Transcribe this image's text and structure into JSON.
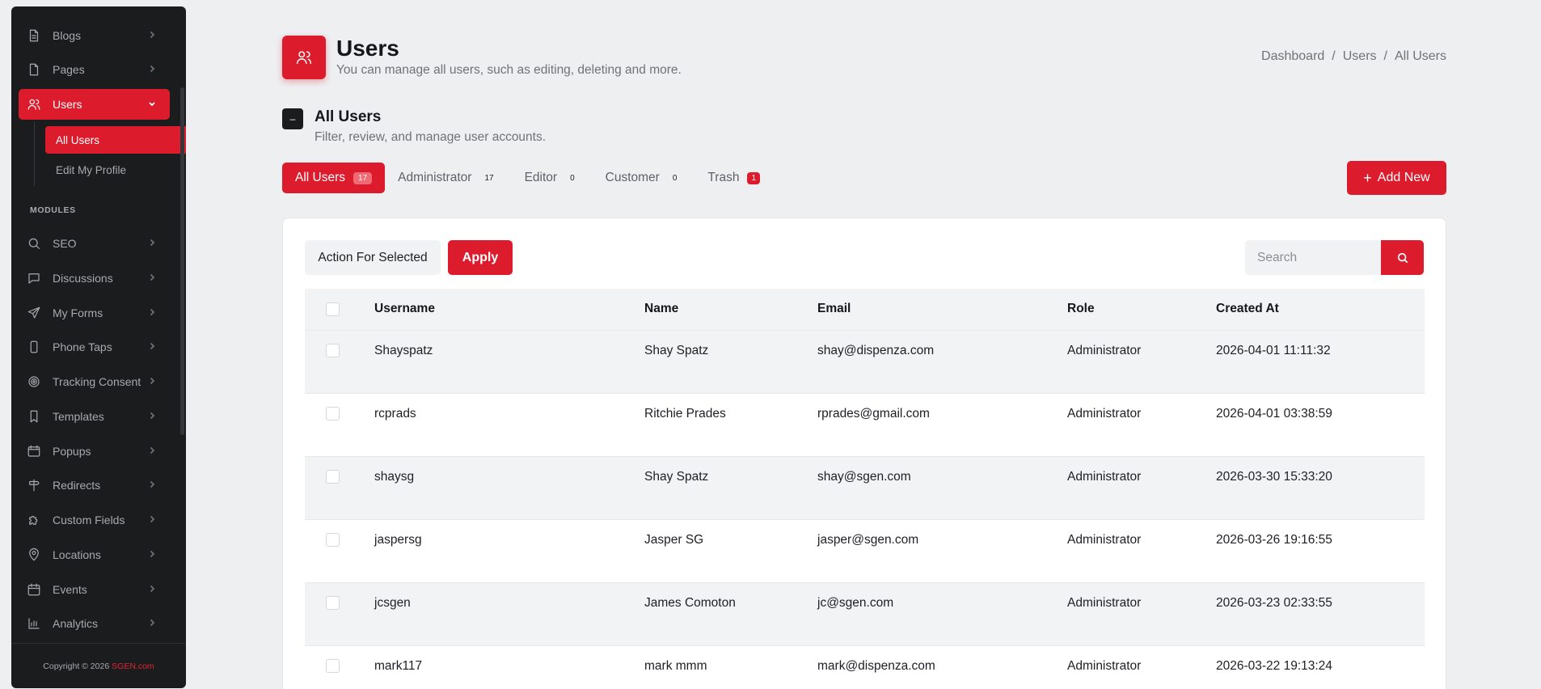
{
  "sidebar": {
    "items": [
      {
        "label": "Blogs",
        "icon": "document-icon"
      },
      {
        "label": "Pages",
        "icon": "page-icon"
      },
      {
        "label": "Users",
        "icon": "users-icon",
        "active": true
      },
      {
        "label": "SEO",
        "icon": "search-icon"
      },
      {
        "label": "Discussions",
        "icon": "chat-icon"
      },
      {
        "label": "My Forms",
        "icon": "send-icon"
      },
      {
        "label": "Phone Taps",
        "icon": "phone-icon"
      },
      {
        "label": "Tracking Consent",
        "icon": "target-icon"
      },
      {
        "label": "Templates",
        "icon": "bookmark-icon"
      },
      {
        "label": "Popups",
        "icon": "window-icon"
      },
      {
        "label": "Redirects",
        "icon": "signpost-icon"
      },
      {
        "label": "Custom Fields",
        "icon": "puzzle-icon"
      },
      {
        "label": "Locations",
        "icon": "map-pin-icon"
      },
      {
        "label": "Events",
        "icon": "calendar-icon"
      },
      {
        "label": "Analytics",
        "icon": "bar-chart-icon"
      }
    ],
    "subitems": [
      {
        "label": "All Users",
        "active": true
      },
      {
        "label": "Edit My Profile"
      }
    ],
    "modules_heading": "MODULES",
    "footer": {
      "copyright": "Copyright © 2026",
      "brand": "SGEN.com"
    }
  },
  "header": {
    "title": "Users",
    "subtitle": "You can manage all users, such as editing, deleting and more.",
    "breadcrumb": [
      "Dashboard",
      "Users",
      "All Users"
    ]
  },
  "section": {
    "icon_glyph": "–",
    "title": "All Users",
    "subtitle": "Filter, review, and manage user accounts."
  },
  "tabs": [
    {
      "label": "All Users",
      "count": "17",
      "active": true
    },
    {
      "label": "Administrator",
      "count": "17"
    },
    {
      "label": "Editor",
      "count": "0"
    },
    {
      "label": "Customer",
      "count": "0"
    },
    {
      "label": "Trash",
      "count": "1"
    }
  ],
  "add_new_label": "Add New",
  "toolbar": {
    "action_select": "Action For Selected",
    "apply_label": "Apply",
    "search_placeholder": "Search"
  },
  "table": {
    "columns": [
      "Username",
      "Name",
      "Email",
      "Role",
      "Created At"
    ],
    "rows": [
      [
        "Shayspatz",
        "Shay Spatz",
        "shay@dispenza.com",
        "Administrator",
        "2026-04-01 11:11:32"
      ],
      [
        "rcprads",
        "Ritchie Prades",
        "rprades@gmail.com",
        "Administrator",
        "2026-04-01 03:38:59"
      ],
      [
        "shaysg",
        "Shay Spatz",
        "shay@sgen.com",
        "Administrator",
        "2026-03-30 15:33:20"
      ],
      [
        "jaspersg",
        "Jasper SG",
        "jasper@sgen.com",
        "Administrator",
        "2026-03-26 19:16:55"
      ],
      [
        "jcsgen",
        "James Comoton",
        "jc@sgen.com",
        "Administrator",
        "2026-03-23 02:33:55"
      ],
      [
        "mark117",
        "mark mmm",
        "mark@dispenza.com",
        "Administrator",
        "2026-03-22 19:13:24"
      ]
    ]
  },
  "colors": {
    "accent": "#dc1c2c",
    "sidebar_bg": "#1b1c1e",
    "page_bg": "#eeeff1"
  }
}
